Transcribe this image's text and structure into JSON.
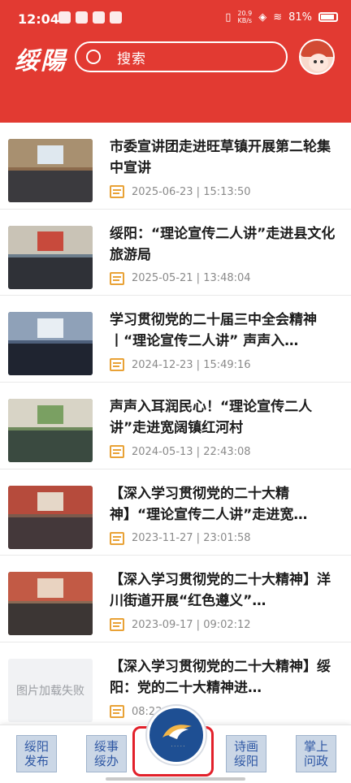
{
  "status_bar": {
    "time": "12:04",
    "net_speed": "20.9\nKB/s",
    "battery": "81%"
  },
  "header": {
    "logo_text": "绥陽",
    "search_placeholder": "搜索"
  },
  "news": [
    {
      "title": "市委宣讲团走进旺草镇开展第二轮集中宣讲",
      "date": "2025-06-23 | 15:13:50",
      "thumb": "photo"
    },
    {
      "title": "绥阳：“理论宣传二人讲”走进县文化旅游局",
      "date": "2025-05-21 | 13:48:04",
      "thumb": "photo"
    },
    {
      "title": "学习贯彻党的二十届三中全会精神丨“理论宣传二人讲” 声声入…",
      "date": "2024-12-23 | 15:49:16",
      "thumb": "photo"
    },
    {
      "title": "声声入耳润民心！“理论宣传二人讲”走进宽阔镇红河村",
      "date": "2024-05-13 | 22:43:08",
      "thumb": "photo"
    },
    {
      "title": "【深入学习贯彻党的二十大精神】“理论宣传二人讲”走进宽…",
      "date": "2023-11-27 | 23:01:58",
      "thumb": "photo"
    },
    {
      "title": "【深入学习贯彻党的二十大精神】洋川街道开展“红色遵义”…",
      "date": "2023-09-17 | 09:02:12",
      "thumb": "photo"
    },
    {
      "title": "【深入学习贯彻党的二十大精神】绥阳：党的二十大精神进…",
      "date": "08:22:57",
      "thumb": "failed",
      "thumb_text": "图片加载失败"
    }
  ],
  "bottom_nav": {
    "tab1": "绥阳发布",
    "tab2": "绥事绥办",
    "tab4": "诗画绥阳",
    "tab5": "掌上问政"
  },
  "colors": {
    "brand": "#e23a32",
    "accent": "#e9a236",
    "nav_text": "#2d56a3"
  }
}
